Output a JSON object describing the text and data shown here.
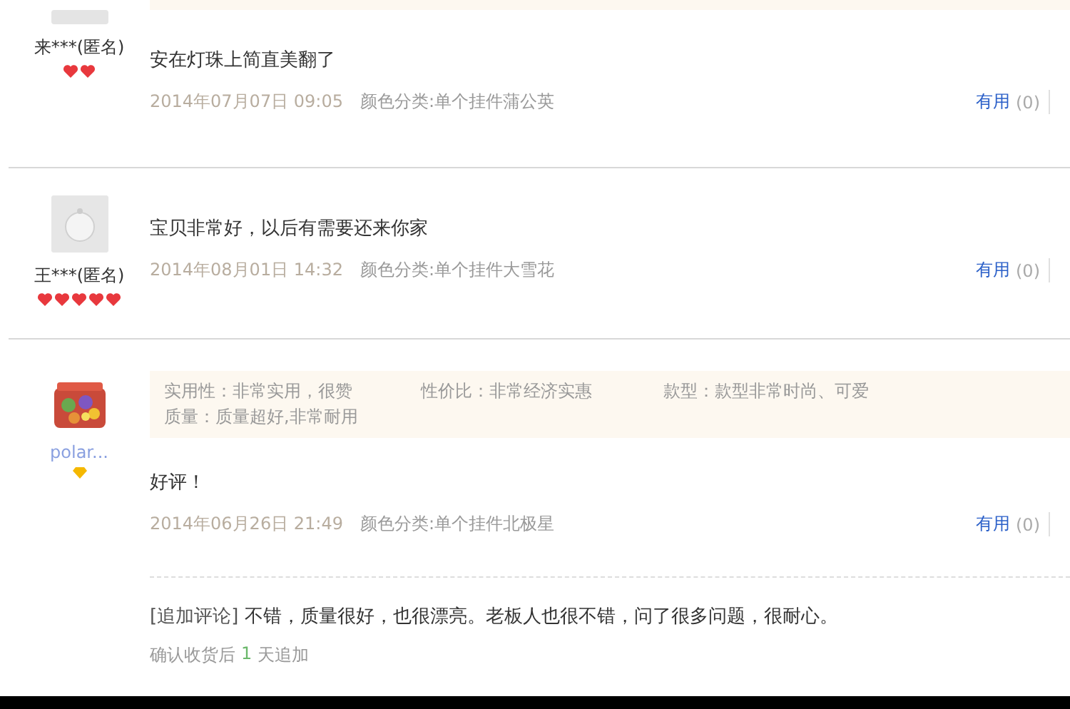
{
  "reviews": [
    {
      "user": {
        "name": "来***(匿名)",
        "badge": [
          {
            "kind": "heart"
          },
          {
            "kind": "heart"
          }
        ],
        "avatar": {
          "kind": "cut"
        }
      },
      "text": "安在灯珠上简直美翻了",
      "date": "2014年07月07日 09:05",
      "sku": "颜色分类:单个挂件蒲公英",
      "useful": {
        "label": "有用",
        "count": "(0)"
      }
    },
    {
      "user": {
        "name": "王***(匿名)",
        "badge": [
          {
            "kind": "heart"
          },
          {
            "kind": "heart"
          },
          {
            "kind": "heart"
          },
          {
            "kind": "heart"
          },
          {
            "kind": "heart"
          }
        ],
        "avatar": {
          "kind": "default"
        }
      },
      "text": "宝贝非常好，以后有需要还来你家",
      "date": "2014年08月01日 14:32",
      "sku": "颜色分类:单个挂件大雪花",
      "useful": {
        "label": "有用",
        "count": "(0)"
      }
    },
    {
      "user": {
        "name": "polar...",
        "badge": [
          {
            "kind": "diamond"
          }
        ]
      },
      "tags": [
        "实用性：非常实用，很赞",
        "性价比：非常经济实惠",
        "款型：款型非常时尚、可爱",
        "质量：质量超好,非常耐用"
      ],
      "text": "好评！",
      "date": "2014年06月26日 21:49",
      "sku": "颜色分类:单个挂件北极星",
      "useful": {
        "label": "有用",
        "count": "(0)"
      },
      "append": {
        "label": "[追加评论]",
        "text": "不错，质量很好，也很漂亮。老板人也很不错，问了很多问题，很耐心。",
        "note_prefix": "确认收货后",
        "note_days": "1",
        "note_suffix": "天追加"
      }
    }
  ]
}
